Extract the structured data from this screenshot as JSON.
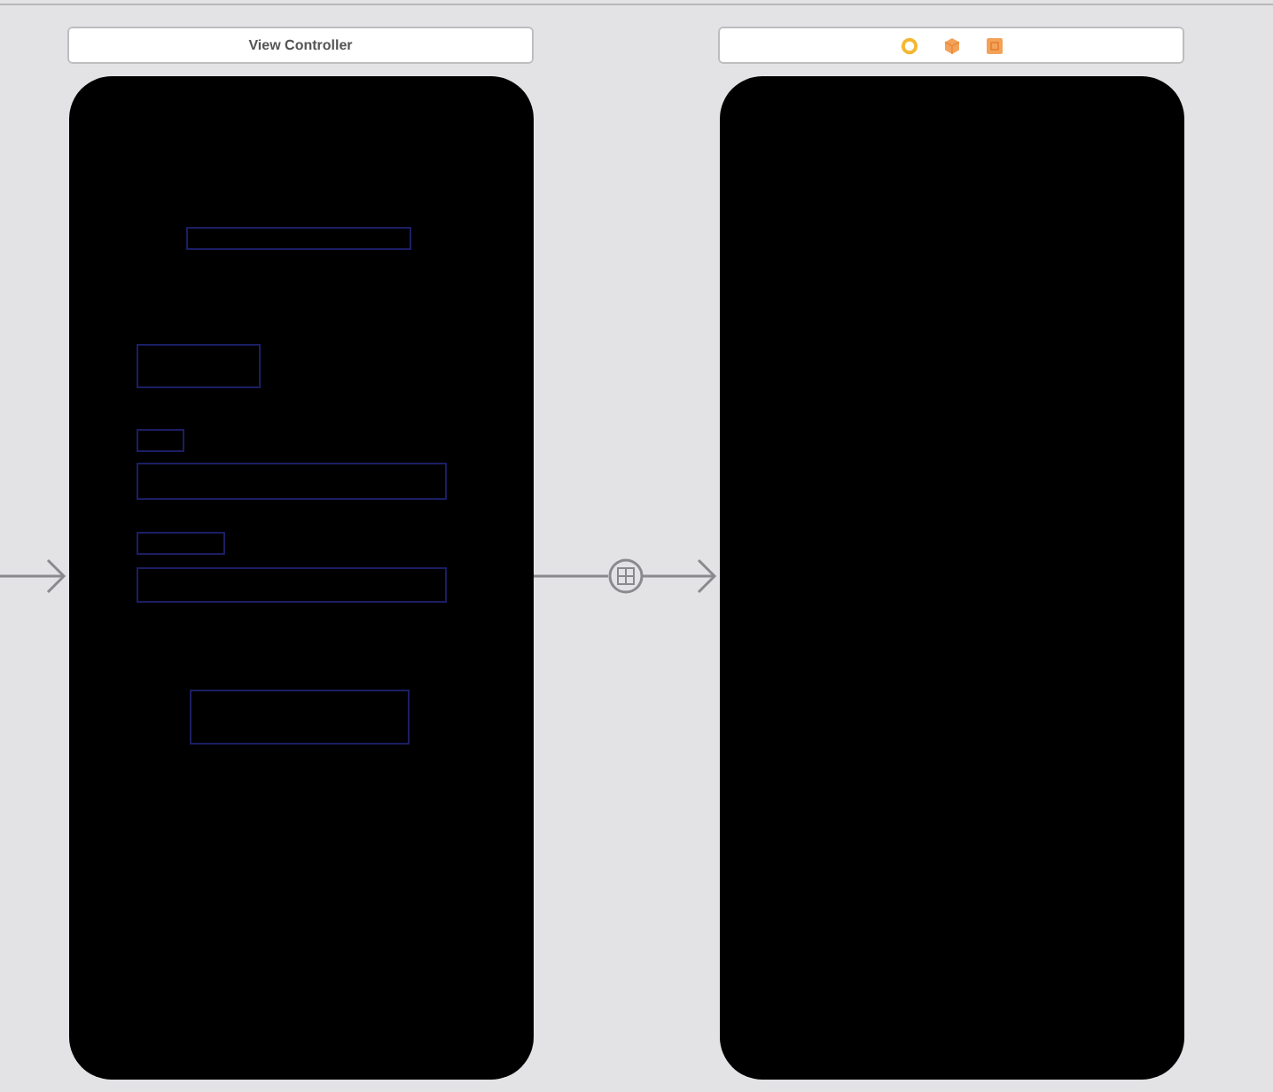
{
  "scenes": [
    {
      "kind": "titled",
      "title": "View Controller"
    },
    {
      "kind": "icons"
    }
  ]
}
